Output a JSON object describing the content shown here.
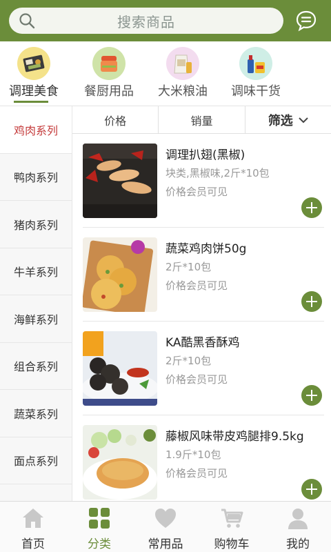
{
  "search": {
    "placeholder": "搜索商品"
  },
  "categories": [
    {
      "label": "调理美食",
      "icon": "bento-box-icon",
      "active": true
    },
    {
      "label": "餐厨用品",
      "icon": "food-container-icon",
      "active": false
    },
    {
      "label": "大米粮油",
      "icon": "rice-bag-icon",
      "active": false
    },
    {
      "label": "调味干货",
      "icon": "seasoning-icon",
      "active": false
    }
  ],
  "sidebar": {
    "items": [
      {
        "label": "鸡肉系列",
        "active": true
      },
      {
        "label": "鸭肉系列"
      },
      {
        "label": "猪肉系列"
      },
      {
        "label": "牛羊系列"
      },
      {
        "label": "海鲜系列"
      },
      {
        "label": "组合系列"
      },
      {
        "label": "蔬菜系列"
      },
      {
        "label": "面点系列"
      }
    ]
  },
  "sort": {
    "price": "价格",
    "sales": "销量",
    "filter": "筛选"
  },
  "products": [
    {
      "name": "调理扒翅(黑椒)",
      "spec": "块类,黑椒味,2斤*10包",
      "price": "价格会员可见"
    },
    {
      "name": "蔬菜鸡肉饼50g",
      "spec": "2斤*10包",
      "price": "价格会员可见"
    },
    {
      "name": "KA酷黑香酥鸡",
      "spec": "2斤*10包",
      "price": "价格会员可见"
    },
    {
      "name": "藤椒风味带皮鸡腿排9.5kg",
      "spec": "1.9斤*10包",
      "price": "价格会员可见"
    }
  ],
  "tabs": [
    {
      "label": "首页",
      "icon": "home-icon"
    },
    {
      "label": "分类",
      "icon": "category-grid-icon",
      "active": true
    },
    {
      "label": "常用品",
      "icon": "heart-icon"
    },
    {
      "label": "购物车",
      "icon": "cart-icon"
    },
    {
      "label": "我的",
      "icon": "user-icon"
    }
  ],
  "colors": {
    "brand": "#6b8d3a",
    "active_side": "#c43a3a"
  }
}
